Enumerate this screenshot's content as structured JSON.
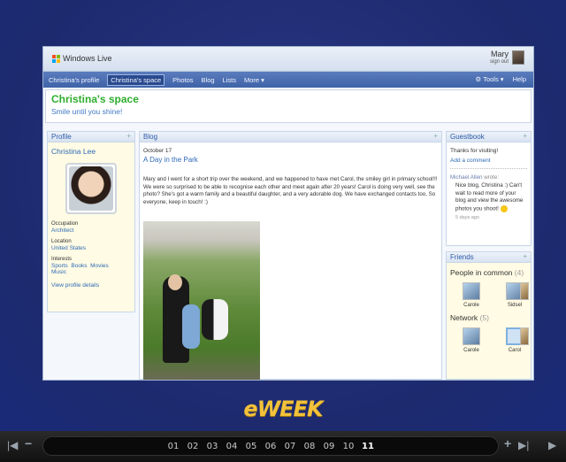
{
  "screenshot": {
    "header": {
      "logo_text": "Windows Live",
      "user_name": "Mary",
      "sign_out": "sign out"
    },
    "nav": {
      "items": [
        "Christina's profile",
        "Christina's space",
        "Photos",
        "Blog",
        "Lists",
        "More"
      ],
      "tools": "Tools",
      "help": "Help"
    },
    "space": {
      "title": "Christina's space",
      "subtitle": "Smile until you shine!"
    },
    "profile": {
      "heading": "Profile",
      "name": "Christina Lee",
      "occupation_label": "Occupation",
      "occupation": "Architect",
      "location_label": "Location",
      "location": "United States",
      "interests_label": "Interests",
      "interests": [
        "Sports",
        "Books",
        "Movies",
        "Music"
      ],
      "view_link": "View profile details"
    },
    "blog": {
      "heading": "Blog",
      "date": "October 17",
      "post_title": "A Day in the Park",
      "post_text": "Mary and I went for a short trip over the weekend, and we happened to have met Carol, the smiley girl in primary school!!! We were so surprised to be able to recognise each other and meet again after 20 years! Carol is doing very well, see the photo? She's got a warm family and a beautiful daughter, and a very adorable dog. We have exchanged contacts too, So everyone, keep in touch! :)"
    },
    "guestbook": {
      "heading": "Guestbook",
      "thanks": "Thanks for visiting!",
      "add_comment": "Add a comment",
      "author": "Michael Allen",
      "wrote": "wrote:",
      "message": "Nice blog, Christina :) Can't wait to read more of your blog and view the awesome photos you shoot!",
      "time": "5 days ago"
    },
    "friends": {
      "heading": "Friends",
      "common_label": "People in common",
      "common_count": "(4)",
      "common": [
        "Carole",
        "Sidsel"
      ],
      "network_label": "Network",
      "network_count": "(5)",
      "network": [
        "Carole",
        "Carol"
      ]
    }
  },
  "brand": {
    "text": "eWEEK"
  },
  "player": {
    "pages": [
      "01",
      "02",
      "03",
      "04",
      "05",
      "06",
      "07",
      "08",
      "09",
      "10",
      "11"
    ],
    "current_page": "11"
  }
}
